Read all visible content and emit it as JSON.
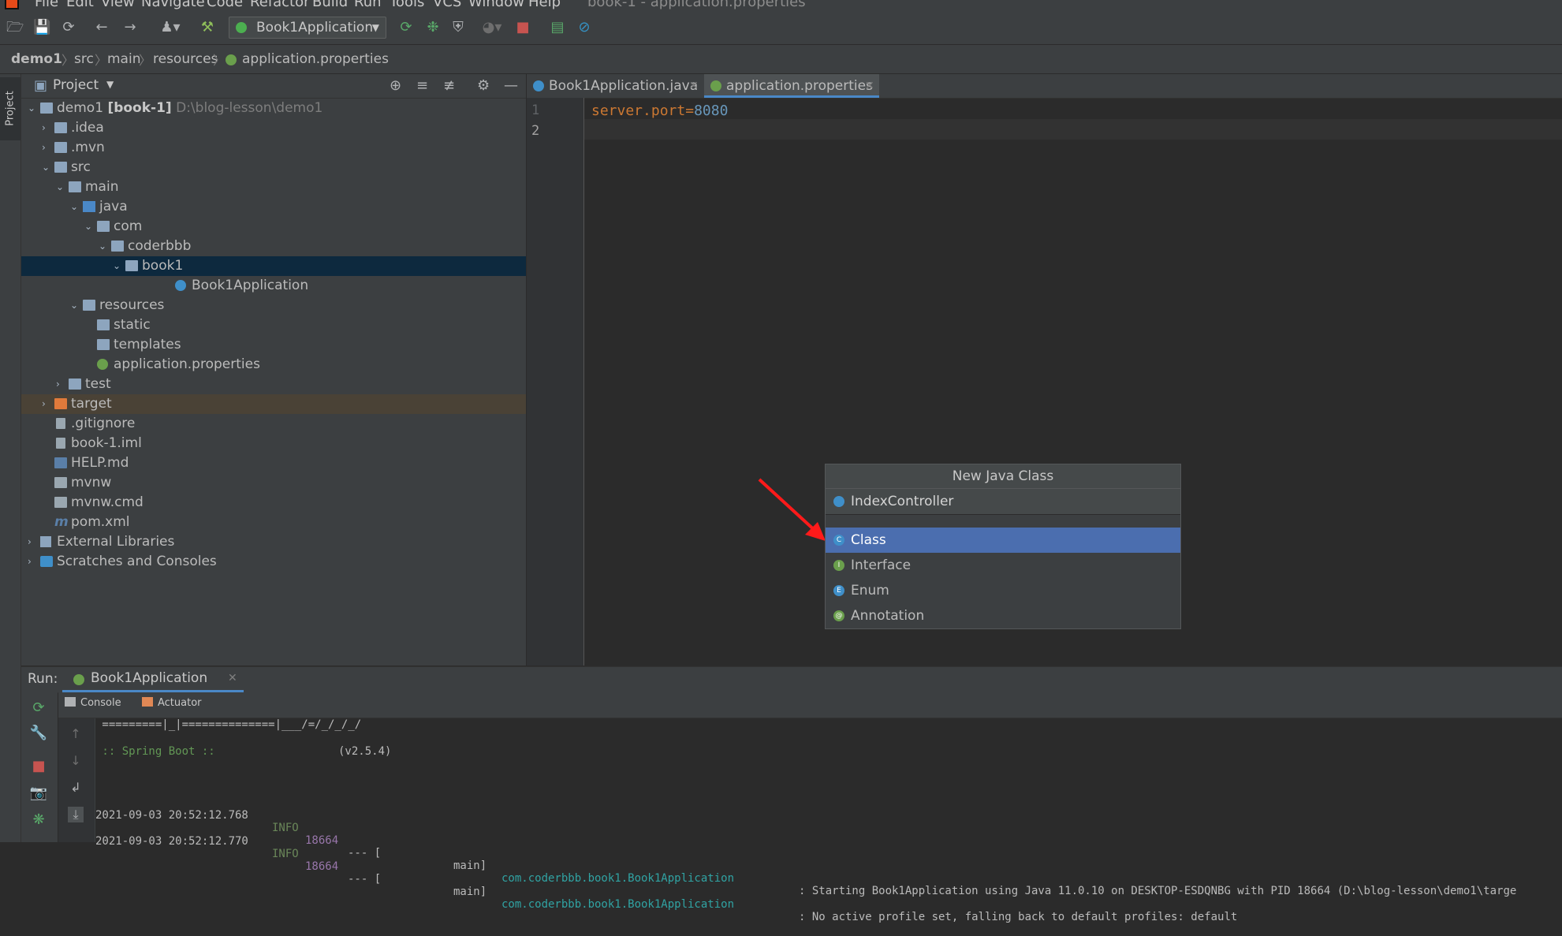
{
  "menubar": {
    "items": [
      "File",
      "Edit",
      "View",
      "Navigate",
      "Code",
      "Refactor",
      "Build",
      "Run",
      "Tools",
      "VCS",
      "Window",
      "Help"
    ],
    "window_title": "book-1 - application.properties"
  },
  "toolbar": {
    "run_config": "Book1Application"
  },
  "breadcrumb": [
    "demo1",
    "src",
    "main",
    "resources",
    "application.properties"
  ],
  "left_strip": {
    "project_tab": "Project"
  },
  "project_panel": {
    "title": "Project",
    "tree": [
      {
        "label": "demo1",
        "bold": "[book-1]",
        "path": "D:\\blog-lesson\\demo1"
      },
      {
        "label": ".idea"
      },
      {
        "label": ".mvn"
      },
      {
        "label": "src"
      },
      {
        "label": "main"
      },
      {
        "label": "java"
      },
      {
        "label": "com"
      },
      {
        "label": "coderbbb"
      },
      {
        "label": "book1"
      },
      {
        "label": "Book1Application"
      },
      {
        "label": "resources"
      },
      {
        "label": "static"
      },
      {
        "label": "templates"
      },
      {
        "label": "application.properties"
      },
      {
        "label": "test"
      },
      {
        "label": "target"
      },
      {
        "label": ".gitignore"
      },
      {
        "label": "book-1.iml"
      },
      {
        "label": "HELP.md"
      },
      {
        "label": "mvnw"
      },
      {
        "label": "mvnw.cmd"
      },
      {
        "label": "pom.xml"
      },
      {
        "label": "External Libraries"
      },
      {
        "label": "Scratches and Consoles"
      }
    ]
  },
  "editor": {
    "tabs": [
      {
        "label": "Book1Application.java",
        "active": false
      },
      {
        "label": "application.properties",
        "active": true
      }
    ],
    "line_numbers": [
      "1",
      "2"
    ],
    "code": {
      "key": "server.port",
      "eq": "=",
      "value": "8080"
    }
  },
  "popup": {
    "title": "New Java Class",
    "input_value": "IndexController",
    "options": [
      {
        "label": "Class",
        "icon": "C",
        "color": "#3f8fc9",
        "selected": true
      },
      {
        "label": "Interface",
        "icon": "I",
        "color": "#6a9f4c",
        "selected": false
      },
      {
        "label": "Enum",
        "icon": "E",
        "color": "#3f8fc9",
        "selected": false
      },
      {
        "label": "Annotation",
        "icon": "@",
        "color": "#6a9f4c",
        "selected": false
      }
    ]
  },
  "run_panel": {
    "label": "Run:",
    "tab": "Book1Application",
    "console_tabs": [
      "Console",
      "Actuator"
    ],
    "console": {
      "banner_line": " =========|_|==============|___/=/_/_/_/",
      "spring_boot": " :: Spring Boot :: ",
      "spring_version": "(v2.5.4)",
      "log_lines": [
        {
          "ts": "2021-09-03 20:52:12.768",
          "level": "INFO",
          "pid": "18664",
          "sep": "--- [",
          "thread": "main]",
          "logger": "com.coderbbb.book1.Book1Application",
          "msg": ": Starting Book1Application using Java 11.0.10 on DESKTOP-ESDQNBG with PID 18664 (D:\\blog-lesson\\demo1\\targe"
        },
        {
          "ts": "2021-09-03 20:52:12.770",
          "level": "INFO",
          "pid": "18664",
          "sep": "--- [",
          "thread": "main]",
          "logger": "com.coderbbb.book1.Book1Application",
          "msg": ": No active profile set, falling back to default profiles: default"
        }
      ]
    }
  },
  "colors": {
    "accent": "#4b6eaf",
    "background": "#2b2b2b",
    "panel": "#3c3f41",
    "arrow": "#ff1a1a"
  }
}
